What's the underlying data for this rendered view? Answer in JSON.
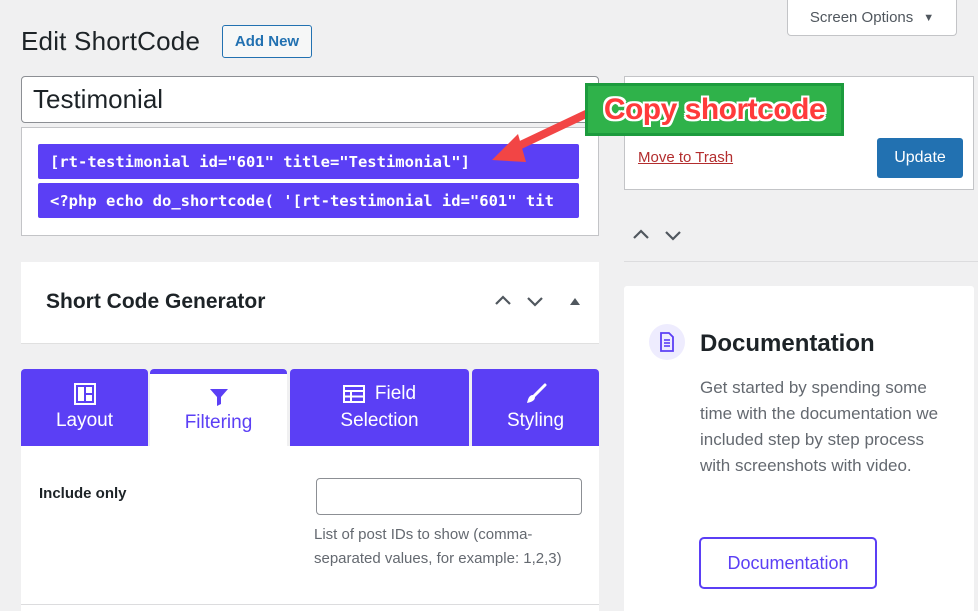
{
  "header": {
    "screen_options": "Screen Options",
    "page_title": "Edit ShortCode",
    "add_new": "Add New"
  },
  "post": {
    "title_value": "Testimonial"
  },
  "shortcodes": {
    "line1": "[rt-testimonial id=\"601\" title=\"Testimonial\"]",
    "line2": "<?php echo do_shortcode( '[rt-testimonial id=\"601\" tit"
  },
  "annotation": {
    "callout_text": "Copy shortcode",
    "callout_bg": "#2fb24a",
    "callout_text_color": "#ff3b3b",
    "arrow_color": "#f24545"
  },
  "publish": {
    "trash_label": "Move to Trash",
    "update_label": "Update"
  },
  "generator": {
    "title": "Short Code Generator",
    "tabs": [
      {
        "label": "Layout",
        "icon": "layout-icon",
        "active": false
      },
      {
        "label": "Filtering",
        "icon": "funnel-icon",
        "active": true
      },
      {
        "label": "Field Selection",
        "label_line1": "Field",
        "label_line2": "Selection",
        "icon": "table-icon",
        "active": false
      },
      {
        "label": "Styling",
        "icon": "brush-icon",
        "active": false
      }
    ],
    "include_only_label": "Include only",
    "include_only_value": "",
    "include_only_help": "List of post IDs to show (comma-separated values, for example: 1,2,3)"
  },
  "documentation": {
    "title": "Documentation",
    "text": "Get started by spending some time with the documentation we included step by step process with screenshots with video.",
    "button_label": "Documentation",
    "icon": "document-icon"
  },
  "colors": {
    "accent": "#5b3ff5",
    "wp_blue": "#2271b1",
    "trash_red": "#b32d2e",
    "background": "#f0f0f1"
  }
}
